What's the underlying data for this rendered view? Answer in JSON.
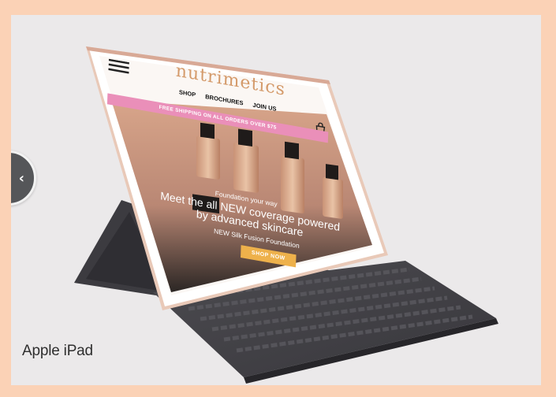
{
  "caption": "Apple iPad",
  "screen": {
    "brand": "nutrimetics",
    "nav": [
      "SHOP",
      "BROCHURES",
      "JOIN US"
    ],
    "promo": "FREE SHIPPING ON ALL ORDERS OVER $75",
    "hero_subtitle": "Foundation your way",
    "hero_title": "Meet the all NEW coverage powered by advanced skincare",
    "hero_desc": "NEW Silk Fusion Foundation",
    "cta": "SHOP NOW"
  },
  "colors": {
    "border": "#fbd2b6",
    "panel": "#ebe9ea",
    "promo": "#ea8fb9",
    "cta": "#eeb14b",
    "brand": "#d49a6a"
  },
  "icons": {
    "prev": "chevron-left-icon",
    "menu": "hamburger-menu-icon",
    "cart": "shopping-bag-icon"
  }
}
